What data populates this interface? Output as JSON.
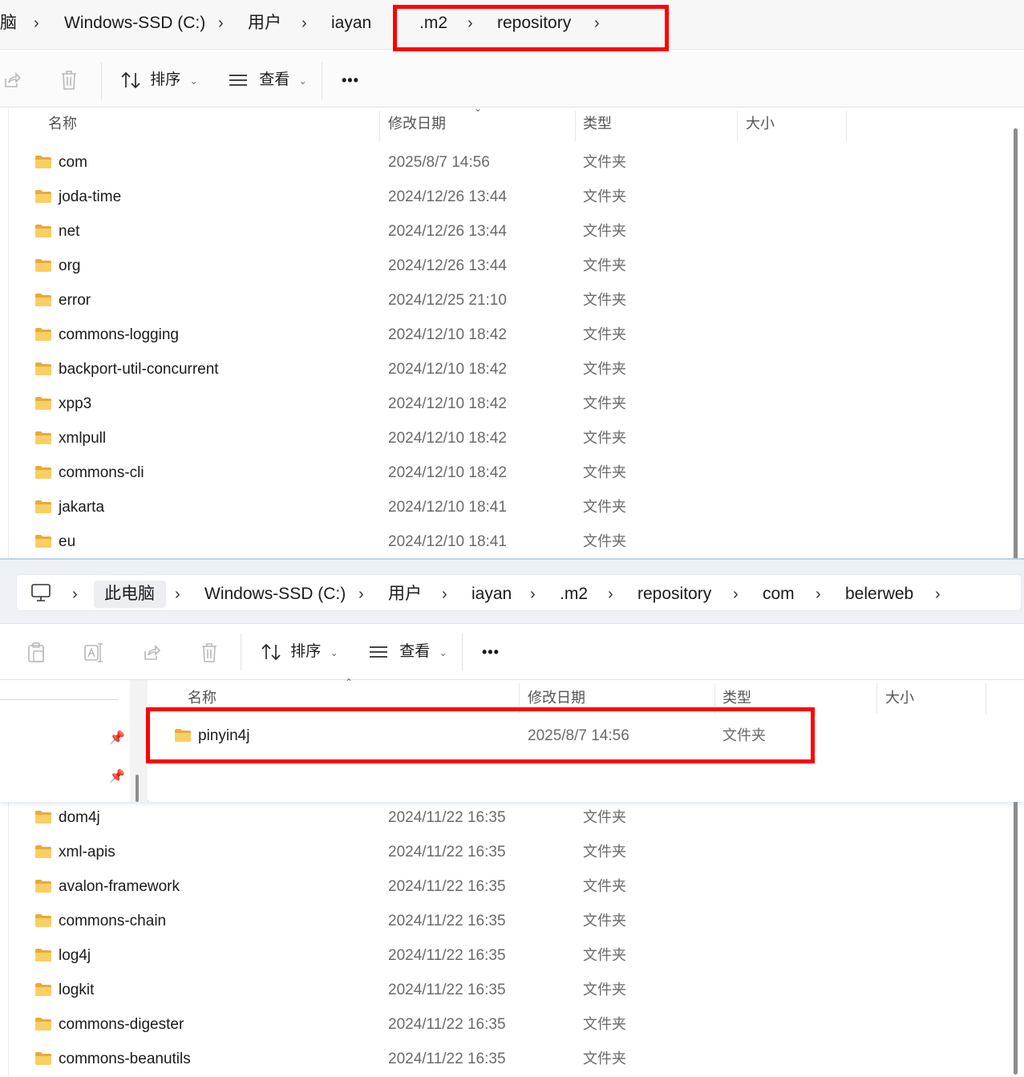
{
  "back_window": {
    "breadcrumb": {
      "partial": "脑",
      "drive": "Windows-SSD (C:)",
      "users": "用户",
      "user": "iayan",
      "m2": ".m2",
      "repo": "repository"
    },
    "toolbar": {
      "sort": "排序",
      "view": "查看",
      "more": "•••"
    },
    "columns": {
      "name": "名称",
      "modified": "修改日期",
      "type": "类型",
      "size": "大小"
    },
    "rows_top": [
      {
        "name": "com",
        "date": "2025/8/7 14:56",
        "type": "文件夹"
      },
      {
        "name": "joda-time",
        "date": "2024/12/26 13:44",
        "type": "文件夹"
      },
      {
        "name": "net",
        "date": "2024/12/26 13:44",
        "type": "文件夹"
      },
      {
        "name": "org",
        "date": "2024/12/26 13:44",
        "type": "文件夹"
      },
      {
        "name": "error",
        "date": "2024/12/25 21:10",
        "type": "文件夹"
      },
      {
        "name": "commons-logging",
        "date": "2024/12/10 18:42",
        "type": "文件夹"
      },
      {
        "name": "backport-util-concurrent",
        "date": "2024/12/10 18:42",
        "type": "文件夹"
      },
      {
        "name": "xpp3",
        "date": "2024/12/10 18:42",
        "type": "文件夹"
      },
      {
        "name": "xmlpull",
        "date": "2024/12/10 18:42",
        "type": "文件夹"
      },
      {
        "name": "commons-cli",
        "date": "2024/12/10 18:42",
        "type": "文件夹"
      },
      {
        "name": "jakarta",
        "date": "2024/12/10 18:41",
        "type": "文件夹"
      },
      {
        "name": "eu",
        "date": "2024/12/10 18:41",
        "type": "文件夹"
      }
    ],
    "rows_bottom": [
      {
        "name": "dom4j",
        "date": "2024/11/22 16:35",
        "type": "文件夹"
      },
      {
        "name": "xml-apis",
        "date": "2024/11/22 16:35",
        "type": "文件夹"
      },
      {
        "name": "avalon-framework",
        "date": "2024/11/22 16:35",
        "type": "文件夹"
      },
      {
        "name": "commons-chain",
        "date": "2024/11/22 16:35",
        "type": "文件夹"
      },
      {
        "name": "log4j",
        "date": "2024/11/22 16:35",
        "type": "文件夹"
      },
      {
        "name": "logkit",
        "date": "2024/11/22 16:35",
        "type": "文件夹"
      },
      {
        "name": "commons-digester",
        "date": "2024/11/22 16:35",
        "type": "文件夹"
      },
      {
        "name": "commons-beanutils",
        "date": "2024/11/22 16:35",
        "type": "文件夹"
      }
    ]
  },
  "front_window": {
    "breadcrumb": {
      "pc": "此电脑",
      "drive": "Windows-SSD (C:)",
      "users": "用户",
      "user": "iayan",
      "m2": ".m2",
      "repo": "repository",
      "com": "com",
      "belerweb": "belerweb"
    },
    "toolbar": {
      "sort": "排序",
      "view": "查看",
      "more": "•••"
    },
    "columns": {
      "name": "名称",
      "modified": "修改日期",
      "type": "类型",
      "size": "大小"
    },
    "rows": [
      {
        "name": "pinyin4j",
        "date": "2025/8/7 14:56",
        "type": "文件夹"
      }
    ]
  },
  "icons": {
    "folder": "folder-icon",
    "share": "share-icon",
    "delete": "trash-icon",
    "sort": "sort-arrows-icon",
    "view": "view-lines-icon",
    "computer": "computer-icon",
    "paste": "paste-icon",
    "rename": "rename-icon",
    "pin": "pin-icon"
  },
  "colors": {
    "highlight": "#ff0000",
    "folder": "#f7c75a",
    "window_border": "#bcd2ea"
  }
}
